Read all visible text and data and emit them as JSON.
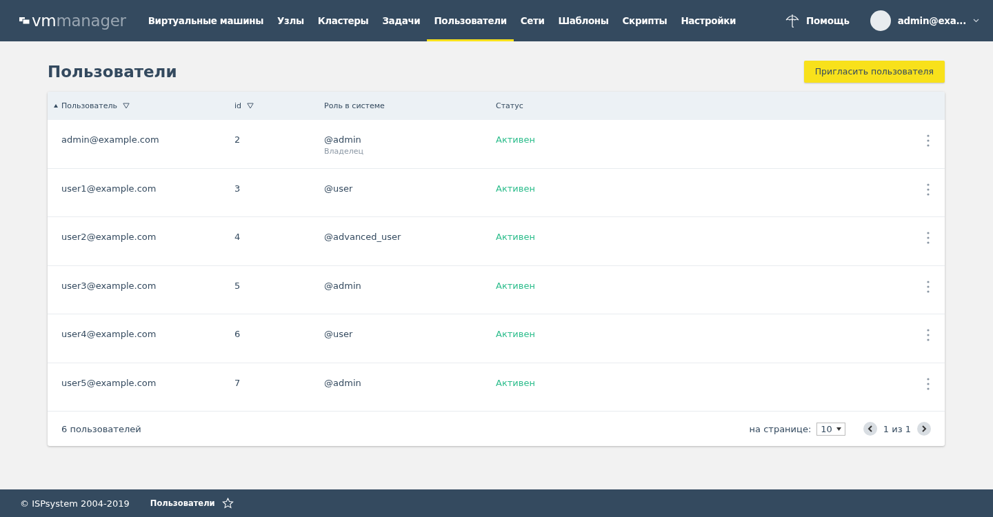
{
  "header": {
    "logo": {
      "primary": "vm",
      "secondary": "manager"
    },
    "nav": [
      {
        "label": "Виртуальные машины",
        "selected": false
      },
      {
        "label": "Узлы",
        "selected": false
      },
      {
        "label": "Кластеры",
        "selected": false
      },
      {
        "label": "Задачи",
        "selected": false
      },
      {
        "label": "Пользователи",
        "selected": true
      },
      {
        "label": "Сети",
        "selected": false
      },
      {
        "label": "Шаблоны",
        "selected": false
      },
      {
        "label": "Скрипты",
        "selected": false
      },
      {
        "label": "Настройки",
        "selected": false
      }
    ],
    "help": "Помощь",
    "account": "admin@exa..."
  },
  "page": {
    "title": "Пользователи",
    "invite_button": "Пригласить пользователя"
  },
  "table": {
    "columns": [
      {
        "label": "Пользователь",
        "sorted": true,
        "filterable": true
      },
      {
        "label": "id",
        "sorted": false,
        "filterable": true
      },
      {
        "label": "Роль в системе",
        "sorted": false,
        "filterable": false
      },
      {
        "label": "Статус",
        "sorted": false,
        "filterable": false
      }
    ],
    "rows": [
      {
        "user": "admin@example.com",
        "id": "2",
        "role": "@admin",
        "role_note": "Владелец",
        "status": "Активен",
        "active": true
      },
      {
        "user": "user1@example.com",
        "id": "3",
        "role": "@user",
        "status": "Активен",
        "active": true
      },
      {
        "user": "user2@example.com",
        "id": "4",
        "role": "@advanced_user",
        "status": "Активен",
        "active": true
      },
      {
        "user": "user3@example.com",
        "id": "5",
        "role": "@admin",
        "status": "Активен",
        "active": true
      },
      {
        "user": "user4@example.com",
        "id": "6",
        "role": "@user",
        "status": "Активен",
        "active": true
      },
      {
        "user": "user5@example.com",
        "id": "7",
        "role": "@admin",
        "status": "Активен",
        "active": true
      }
    ],
    "footer": {
      "count": "6 пользователей",
      "per_page_label": "на странице:",
      "per_page": "10",
      "pages": "1 из 1"
    }
  },
  "status_bar": {
    "copyright": "© ISPsystem 2004-2019",
    "breadcrumb": "Пользователи"
  }
}
